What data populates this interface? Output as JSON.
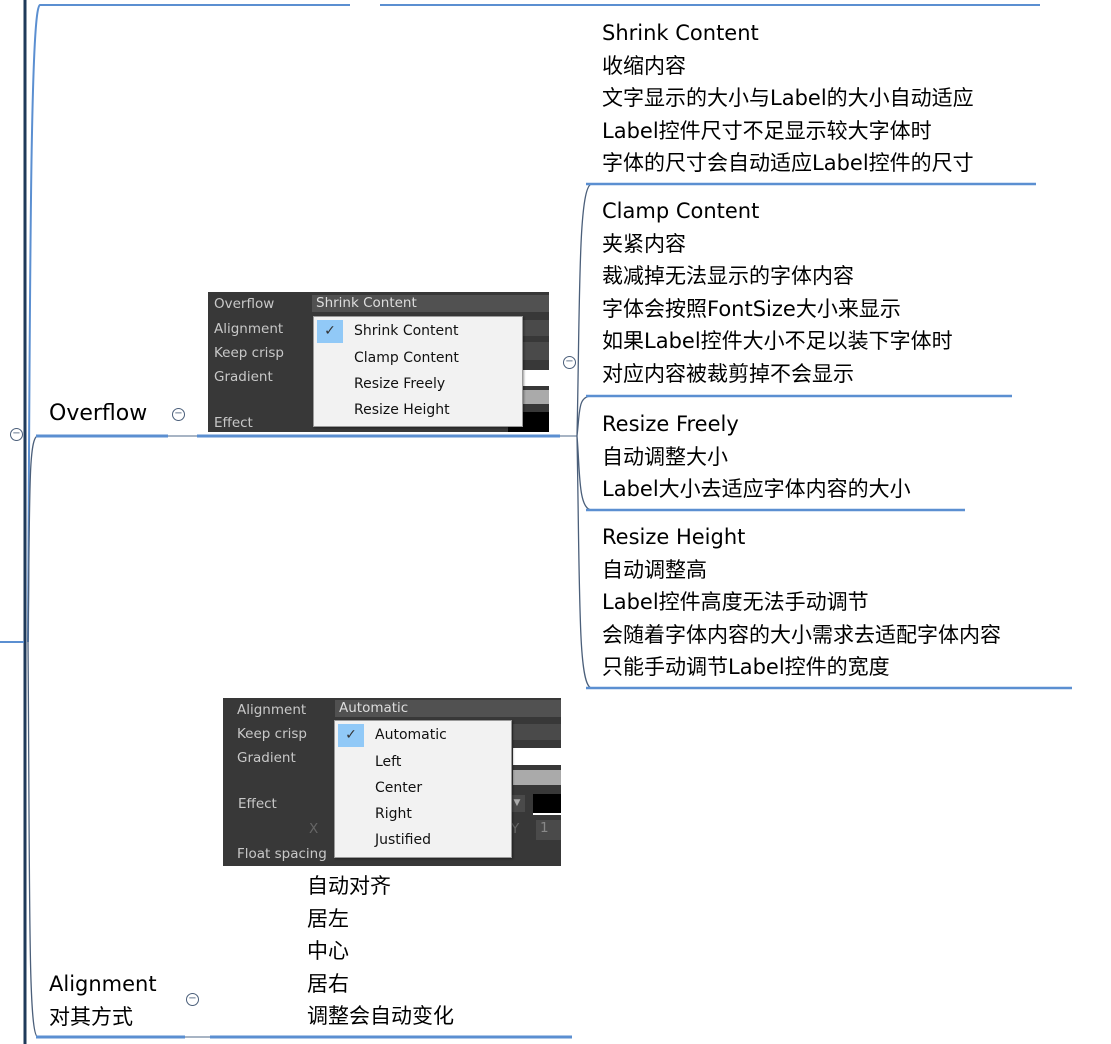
{
  "colors": {
    "trunk": "#1f3a5a",
    "branch": "#5b8fd1",
    "connector": "#4b5f7a"
  },
  "overflow": {
    "title": "Overflow",
    "screenshot": {
      "labels": [
        "Overflow",
        "Alignment",
        "Keep crisp",
        "Gradient",
        "Effect"
      ],
      "selected_value": "Shrink Content",
      "options": [
        "Shrink Content",
        "Clamp Content",
        "Resize Freely",
        "Resize Height"
      ],
      "checked_index": 0
    },
    "children": [
      {
        "lines": [
          "Shrink Content",
          "收缩内容",
          "文字显示的大小与Label的大小自动适应",
          "Label控件尺寸不足显示较大字体时",
          "字体的尺寸会自动适应Label控件的尺寸"
        ]
      },
      {
        "lines": [
          "Clamp Content",
          "夹紧内容",
          "裁减掉无法显示的字体内容",
          "字体会按照FontSize大小来显示",
          "如果Label控件大小不足以装下字体时",
          "对应内容被裁剪掉不会显示"
        ]
      },
      {
        "lines": [
          "Resize Freely",
          "自动调整大小",
          "Label大小去适应字体内容的大小"
        ]
      },
      {
        "lines": [
          "Resize Height",
          "自动调整高",
          "Label控件高度无法手动调节",
          "会随着字体内容的大小需求去适配字体内容",
          "只能手动调节Label控件的宽度"
        ]
      }
    ]
  },
  "alignment": {
    "title_lines": [
      "Alignment",
      "对其方式"
    ],
    "screenshot": {
      "labels": [
        "Alignment",
        "Keep crisp",
        "Gradient",
        "Effect",
        "X",
        "Y",
        "1",
        "Float spacing"
      ],
      "selected_value": "Automatic",
      "options": [
        "Automatic",
        "Left",
        "Center",
        "Right",
        "Justified"
      ],
      "checked_index": 0
    },
    "description_lines": [
      "自动对齐",
      "居左",
      "中心",
      "居右",
      "调整会自动变化"
    ]
  }
}
